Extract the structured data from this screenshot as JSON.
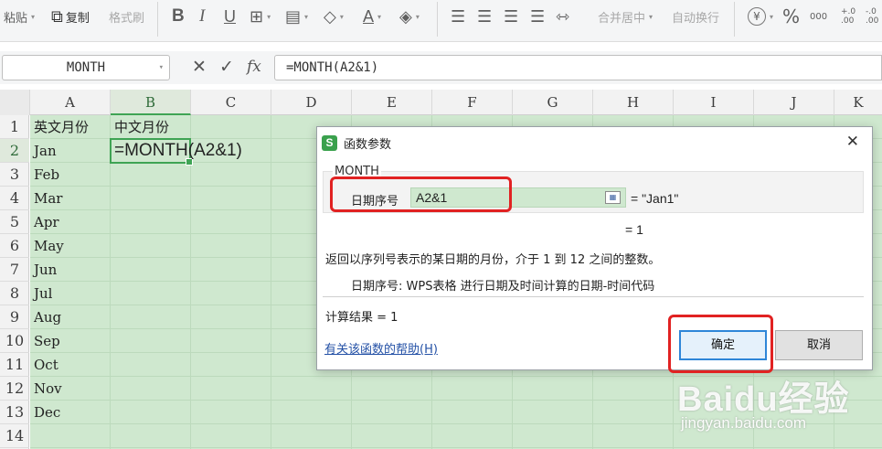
{
  "ribbon": {
    "paste_label": "粘贴",
    "copy_label": "复制",
    "format_painter_label": "格式刷",
    "bold_glyph": "B",
    "italic_glyph": "I",
    "underline_glyph": "U",
    "font_color_glyph": "A",
    "merge_center_label": "合并居中",
    "wrap_text_label": "自动换行",
    "currency_glyph": "¥",
    "percent_glyph": "%",
    "thousands_glyph": "000",
    "inc_decimal_glyph": "+.0 .00",
    "dec_decimal_glyph": "-.0 .00"
  },
  "formula_bar": {
    "name_box": "MONTH",
    "cancel_glyph": "✕",
    "confirm_glyph": "✓",
    "fx_label": "fx",
    "formula": "=MONTH(A2&1)"
  },
  "sheet": {
    "columns": [
      "A",
      "B",
      "C",
      "D",
      "E",
      "F",
      "G",
      "H",
      "I",
      "J",
      "K"
    ],
    "rows": [
      "1",
      "2",
      "3",
      "4",
      "5",
      "6",
      "7",
      "8",
      "9",
      "10",
      "11",
      "12",
      "13",
      "14"
    ],
    "a1": "英文月份",
    "b1": "中文月份",
    "b2_editing": "=MONTH(A2&1)",
    "months": [
      "Jan",
      "Feb",
      "Mar",
      "Apr",
      "May",
      "Jun",
      "Jul",
      "Aug",
      "Sep",
      "Oct",
      "Nov",
      "Dec"
    ]
  },
  "dialog": {
    "logo": "S",
    "title": "函数参数",
    "close_glyph": "✕",
    "function_name": "MONTH",
    "arg_label": "日期序号",
    "arg_value": "A2&1",
    "arg_result": "= \"Jan1\"",
    "function_result_inline": "= 1",
    "function_description": "返回以序列号表示的某日期的月份，介于 1 到 12 之间的整数。",
    "arg_description": "日期序号:  WPS表格 进行日期及时间计算的日期-时间代码",
    "calc_result": "计算结果 = 1",
    "help_link": "有关该函数的帮助(H)",
    "ok_label": "确定",
    "cancel_label": "取消"
  },
  "watermark": {
    "brand": "Baidu经验",
    "url": "jingyan.baidu.com"
  },
  "colors": {
    "cell_fill": "#cfe8cf",
    "selection_green": "#3fa454",
    "highlight_red": "#e12222",
    "ok_focus_blue": "#2e86d8",
    "link_blue": "#2451a6"
  }
}
